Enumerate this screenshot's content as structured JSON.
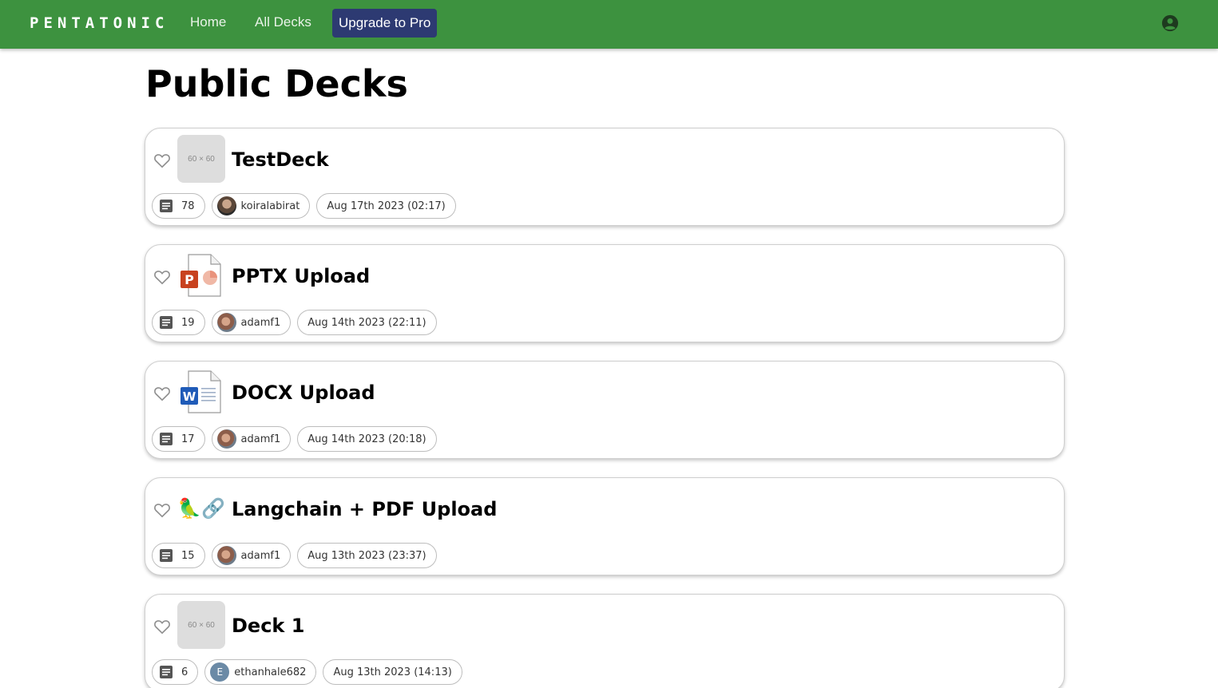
{
  "nav": {
    "brand": "PENTATONIC",
    "home": "Home",
    "all_decks": "All Decks",
    "upgrade": "Upgrade to Pro",
    "profile_icon": "account-circle-icon"
  },
  "page": {
    "title": "Public Decks"
  },
  "decks": [
    {
      "title": "TestDeck",
      "thumb": "60 × 60",
      "count": "78",
      "author": "koiralabirat",
      "date": "Aug 17th 2023 (02:17)"
    },
    {
      "title": "PPTX Upload",
      "thumb_icon": "powerpoint-file-icon",
      "count": "19",
      "author": "adamf1",
      "date": "Aug 14th 2023 (22:11)"
    },
    {
      "title": "DOCX Upload",
      "thumb_icon": "word-file-icon",
      "count": "17",
      "author": "adamf1",
      "date": "Aug 14th 2023 (20:18)"
    },
    {
      "title": "Langchain + PDF Upload",
      "thumb": "🦜🔗",
      "count": "15",
      "author": "adamf1",
      "date": "Aug 13th 2023 (23:37)"
    },
    {
      "title": "Deck 1",
      "thumb": "60 × 60",
      "count": "6",
      "author": "ethanhale682",
      "avatar_letter": "E",
      "date": "Aug 13th 2023 (14:13)"
    }
  ],
  "colors": {
    "nav_bg": "#3d923f",
    "pro_bg": "#2d3a72"
  }
}
